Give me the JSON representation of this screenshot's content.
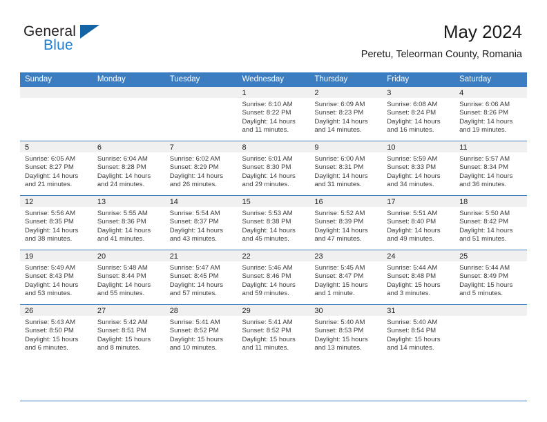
{
  "brand": {
    "name_part1": "General",
    "name_part2": "Blue",
    "accent_color": "#1464a5",
    "text_color": "#1b7fd4"
  },
  "header": {
    "title": "May 2024",
    "subtitle": "Peretu, Teleorman County, Romania"
  },
  "calendar": {
    "header_bg": "#3b7dc0",
    "daynum_bg": "#f0f0f0",
    "weekday_headers": [
      "Sunday",
      "Monday",
      "Tuesday",
      "Wednesday",
      "Thursday",
      "Friday",
      "Saturday"
    ],
    "weeks": [
      [
        {
          "day": "",
          "empty": true,
          "sunrise": "",
          "sunset": "",
          "daylight_line1": "",
          "daylight_line2": ""
        },
        {
          "day": "",
          "empty": true,
          "sunrise": "",
          "sunset": "",
          "daylight_line1": "",
          "daylight_line2": ""
        },
        {
          "day": "",
          "empty": true,
          "sunrise": "",
          "sunset": "",
          "daylight_line1": "",
          "daylight_line2": ""
        },
        {
          "day": "1",
          "empty": false,
          "sunrise": "Sunrise: 6:10 AM",
          "sunset": "Sunset: 8:22 PM",
          "daylight_line1": "Daylight: 14 hours",
          "daylight_line2": "and 11 minutes."
        },
        {
          "day": "2",
          "empty": false,
          "sunrise": "Sunrise: 6:09 AM",
          "sunset": "Sunset: 8:23 PM",
          "daylight_line1": "Daylight: 14 hours",
          "daylight_line2": "and 14 minutes."
        },
        {
          "day": "3",
          "empty": false,
          "sunrise": "Sunrise: 6:08 AM",
          "sunset": "Sunset: 8:24 PM",
          "daylight_line1": "Daylight: 14 hours",
          "daylight_line2": "and 16 minutes."
        },
        {
          "day": "4",
          "empty": false,
          "sunrise": "Sunrise: 6:06 AM",
          "sunset": "Sunset: 8:26 PM",
          "daylight_line1": "Daylight: 14 hours",
          "daylight_line2": "and 19 minutes."
        }
      ],
      [
        {
          "day": "5",
          "empty": false,
          "sunrise": "Sunrise: 6:05 AM",
          "sunset": "Sunset: 8:27 PM",
          "daylight_line1": "Daylight: 14 hours",
          "daylight_line2": "and 21 minutes."
        },
        {
          "day": "6",
          "empty": false,
          "sunrise": "Sunrise: 6:04 AM",
          "sunset": "Sunset: 8:28 PM",
          "daylight_line1": "Daylight: 14 hours",
          "daylight_line2": "and 24 minutes."
        },
        {
          "day": "7",
          "empty": false,
          "sunrise": "Sunrise: 6:02 AM",
          "sunset": "Sunset: 8:29 PM",
          "daylight_line1": "Daylight: 14 hours",
          "daylight_line2": "and 26 minutes."
        },
        {
          "day": "8",
          "empty": false,
          "sunrise": "Sunrise: 6:01 AM",
          "sunset": "Sunset: 8:30 PM",
          "daylight_line1": "Daylight: 14 hours",
          "daylight_line2": "and 29 minutes."
        },
        {
          "day": "9",
          "empty": false,
          "sunrise": "Sunrise: 6:00 AM",
          "sunset": "Sunset: 8:31 PM",
          "daylight_line1": "Daylight: 14 hours",
          "daylight_line2": "and 31 minutes."
        },
        {
          "day": "10",
          "empty": false,
          "sunrise": "Sunrise: 5:59 AM",
          "sunset": "Sunset: 8:33 PM",
          "daylight_line1": "Daylight: 14 hours",
          "daylight_line2": "and 34 minutes."
        },
        {
          "day": "11",
          "empty": false,
          "sunrise": "Sunrise: 5:57 AM",
          "sunset": "Sunset: 8:34 PM",
          "daylight_line1": "Daylight: 14 hours",
          "daylight_line2": "and 36 minutes."
        }
      ],
      [
        {
          "day": "12",
          "empty": false,
          "sunrise": "Sunrise: 5:56 AM",
          "sunset": "Sunset: 8:35 PM",
          "daylight_line1": "Daylight: 14 hours",
          "daylight_line2": "and 38 minutes."
        },
        {
          "day": "13",
          "empty": false,
          "sunrise": "Sunrise: 5:55 AM",
          "sunset": "Sunset: 8:36 PM",
          "daylight_line1": "Daylight: 14 hours",
          "daylight_line2": "and 41 minutes."
        },
        {
          "day": "14",
          "empty": false,
          "sunrise": "Sunrise: 5:54 AM",
          "sunset": "Sunset: 8:37 PM",
          "daylight_line1": "Daylight: 14 hours",
          "daylight_line2": "and 43 minutes."
        },
        {
          "day": "15",
          "empty": false,
          "sunrise": "Sunrise: 5:53 AM",
          "sunset": "Sunset: 8:38 PM",
          "daylight_line1": "Daylight: 14 hours",
          "daylight_line2": "and 45 minutes."
        },
        {
          "day": "16",
          "empty": false,
          "sunrise": "Sunrise: 5:52 AM",
          "sunset": "Sunset: 8:39 PM",
          "daylight_line1": "Daylight: 14 hours",
          "daylight_line2": "and 47 minutes."
        },
        {
          "day": "17",
          "empty": false,
          "sunrise": "Sunrise: 5:51 AM",
          "sunset": "Sunset: 8:40 PM",
          "daylight_line1": "Daylight: 14 hours",
          "daylight_line2": "and 49 minutes."
        },
        {
          "day": "18",
          "empty": false,
          "sunrise": "Sunrise: 5:50 AM",
          "sunset": "Sunset: 8:42 PM",
          "daylight_line1": "Daylight: 14 hours",
          "daylight_line2": "and 51 minutes."
        }
      ],
      [
        {
          "day": "19",
          "empty": false,
          "sunrise": "Sunrise: 5:49 AM",
          "sunset": "Sunset: 8:43 PM",
          "daylight_line1": "Daylight: 14 hours",
          "daylight_line2": "and 53 minutes."
        },
        {
          "day": "20",
          "empty": false,
          "sunrise": "Sunrise: 5:48 AM",
          "sunset": "Sunset: 8:44 PM",
          "daylight_line1": "Daylight: 14 hours",
          "daylight_line2": "and 55 minutes."
        },
        {
          "day": "21",
          "empty": false,
          "sunrise": "Sunrise: 5:47 AM",
          "sunset": "Sunset: 8:45 PM",
          "daylight_line1": "Daylight: 14 hours",
          "daylight_line2": "and 57 minutes."
        },
        {
          "day": "22",
          "empty": false,
          "sunrise": "Sunrise: 5:46 AM",
          "sunset": "Sunset: 8:46 PM",
          "daylight_line1": "Daylight: 14 hours",
          "daylight_line2": "and 59 minutes."
        },
        {
          "day": "23",
          "empty": false,
          "sunrise": "Sunrise: 5:45 AM",
          "sunset": "Sunset: 8:47 PM",
          "daylight_line1": "Daylight: 15 hours",
          "daylight_line2": "and 1 minute."
        },
        {
          "day": "24",
          "empty": false,
          "sunrise": "Sunrise: 5:44 AM",
          "sunset": "Sunset: 8:48 PM",
          "daylight_line1": "Daylight: 15 hours",
          "daylight_line2": "and 3 minutes."
        },
        {
          "day": "25",
          "empty": false,
          "sunrise": "Sunrise: 5:44 AM",
          "sunset": "Sunset: 8:49 PM",
          "daylight_line1": "Daylight: 15 hours",
          "daylight_line2": "and 5 minutes."
        }
      ],
      [
        {
          "day": "26",
          "empty": false,
          "sunrise": "Sunrise: 5:43 AM",
          "sunset": "Sunset: 8:50 PM",
          "daylight_line1": "Daylight: 15 hours",
          "daylight_line2": "and 6 minutes."
        },
        {
          "day": "27",
          "empty": false,
          "sunrise": "Sunrise: 5:42 AM",
          "sunset": "Sunset: 8:51 PM",
          "daylight_line1": "Daylight: 15 hours",
          "daylight_line2": "and 8 minutes."
        },
        {
          "day": "28",
          "empty": false,
          "sunrise": "Sunrise: 5:41 AM",
          "sunset": "Sunset: 8:52 PM",
          "daylight_line1": "Daylight: 15 hours",
          "daylight_line2": "and 10 minutes."
        },
        {
          "day": "29",
          "empty": false,
          "sunrise": "Sunrise: 5:41 AM",
          "sunset": "Sunset: 8:52 PM",
          "daylight_line1": "Daylight: 15 hours",
          "daylight_line2": "and 11 minutes."
        },
        {
          "day": "30",
          "empty": false,
          "sunrise": "Sunrise: 5:40 AM",
          "sunset": "Sunset: 8:53 PM",
          "daylight_line1": "Daylight: 15 hours",
          "daylight_line2": "and 13 minutes."
        },
        {
          "day": "31",
          "empty": false,
          "sunrise": "Sunrise: 5:40 AM",
          "sunset": "Sunset: 8:54 PM",
          "daylight_line1": "Daylight: 15 hours",
          "daylight_line2": "and 14 minutes."
        },
        {
          "day": "",
          "empty": true,
          "sunrise": "",
          "sunset": "",
          "daylight_line1": "",
          "daylight_line2": ""
        }
      ]
    ]
  }
}
